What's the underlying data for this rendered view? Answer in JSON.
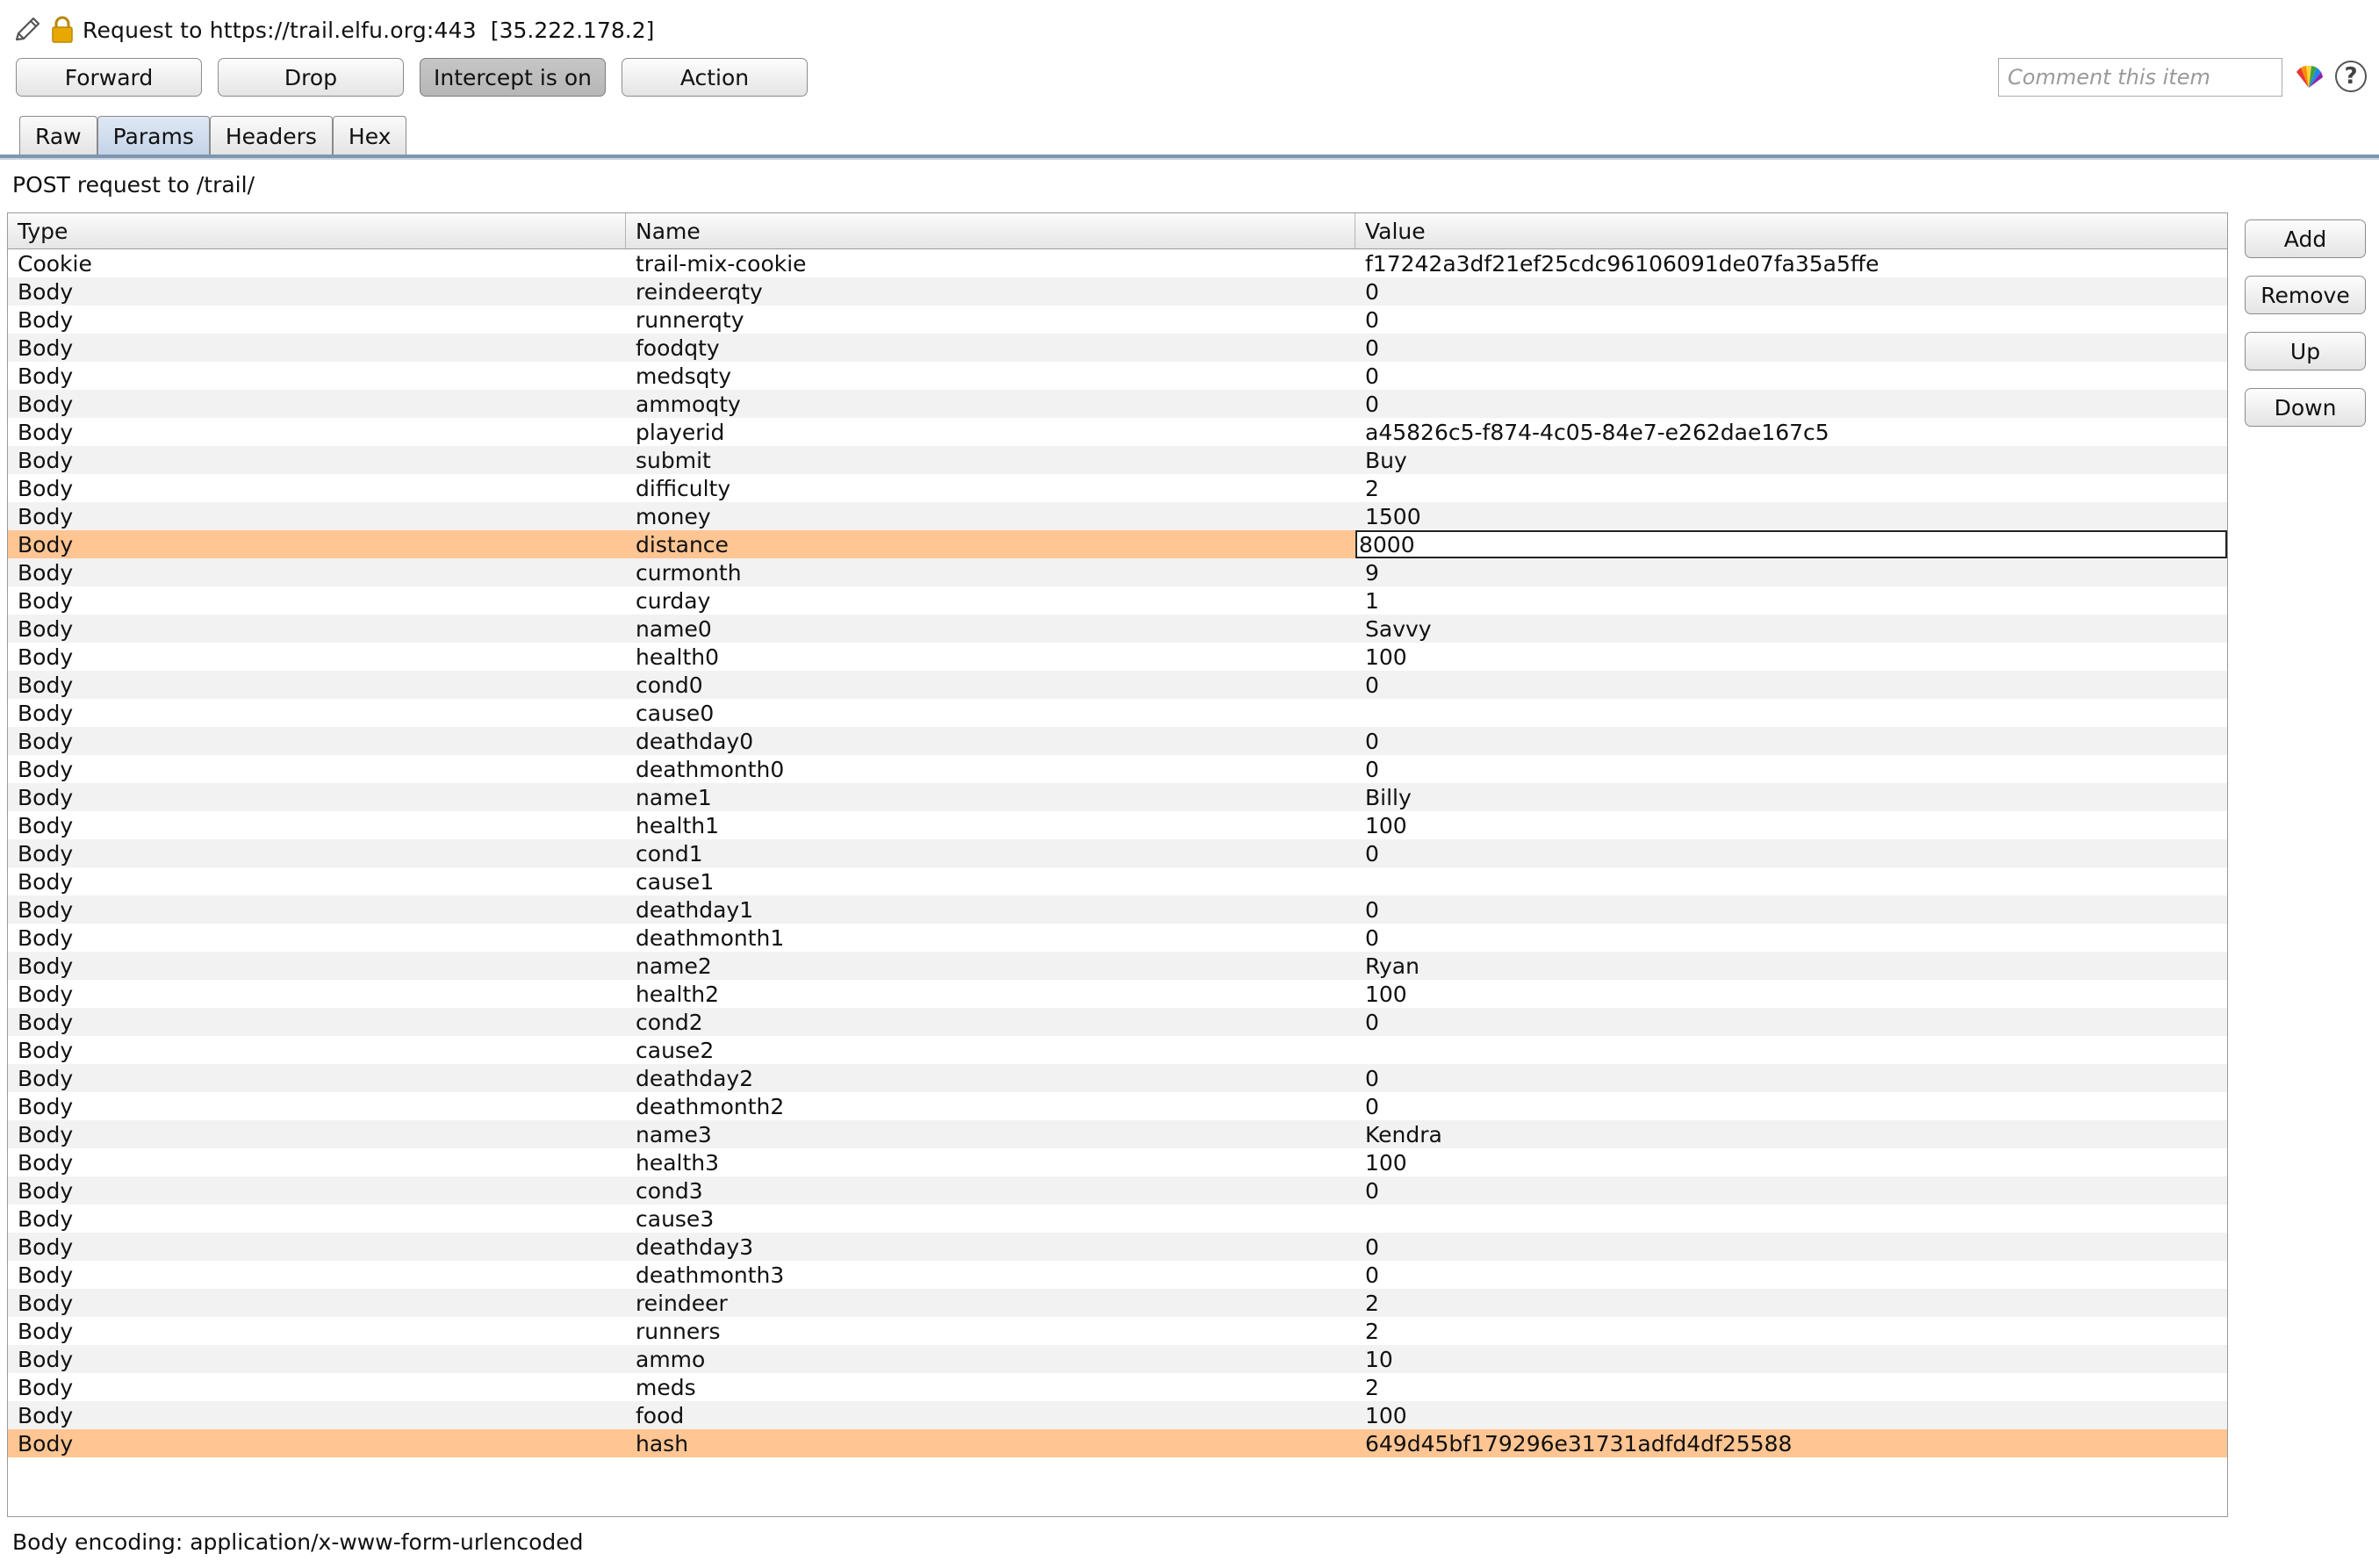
{
  "request_line": {
    "text": "Request to https://trail.elfu.org:443",
    "ip": "[35.222.178.2]"
  },
  "toolbar": {
    "forward": "Forward",
    "drop": "Drop",
    "intercept": "Intercept is on",
    "action": "Action",
    "comment_placeholder": "Comment this item"
  },
  "tabs": [
    {
      "label": "Raw"
    },
    {
      "label": "Params",
      "active": true
    },
    {
      "label": "Headers"
    },
    {
      "label": "Hex"
    }
  ],
  "request_summary": "POST request to /trail/",
  "table": {
    "headers": [
      "Type",
      "Name",
      "Value"
    ],
    "rows": [
      {
        "type": "Cookie",
        "name": "trail-mix-cookie",
        "value": "f17242a3df21ef25cdc96106091de07fa35a5ffe"
      },
      {
        "type": "Body",
        "name": "reindeerqty",
        "value": "0"
      },
      {
        "type": "Body",
        "name": "runnerqty",
        "value": "0"
      },
      {
        "type": "Body",
        "name": "foodqty",
        "value": "0"
      },
      {
        "type": "Body",
        "name": "medsqty",
        "value": "0"
      },
      {
        "type": "Body",
        "name": "ammoqty",
        "value": "0"
      },
      {
        "type": "Body",
        "name": "playerid",
        "value": "a45826c5-f874-4c05-84e7-e262dae167c5"
      },
      {
        "type": "Body",
        "name": "submit",
        "value": "Buy"
      },
      {
        "type": "Body",
        "name": "difficulty",
        "value": "2"
      },
      {
        "type": "Body",
        "name": "money",
        "value": "1500"
      },
      {
        "type": "Body",
        "name": "distance",
        "value": "8000",
        "selected": true,
        "editing": true
      },
      {
        "type": "Body",
        "name": "curmonth",
        "value": "9"
      },
      {
        "type": "Body",
        "name": "curday",
        "value": "1"
      },
      {
        "type": "Body",
        "name": "name0",
        "value": "Savvy"
      },
      {
        "type": "Body",
        "name": "health0",
        "value": "100"
      },
      {
        "type": "Body",
        "name": "cond0",
        "value": "0"
      },
      {
        "type": "Body",
        "name": "cause0",
        "value": ""
      },
      {
        "type": "Body",
        "name": "deathday0",
        "value": "0"
      },
      {
        "type": "Body",
        "name": "deathmonth0",
        "value": "0"
      },
      {
        "type": "Body",
        "name": "name1",
        "value": "Billy"
      },
      {
        "type": "Body",
        "name": "health1",
        "value": "100"
      },
      {
        "type": "Body",
        "name": "cond1",
        "value": "0"
      },
      {
        "type": "Body",
        "name": "cause1",
        "value": ""
      },
      {
        "type": "Body",
        "name": "deathday1",
        "value": "0"
      },
      {
        "type": "Body",
        "name": "deathmonth1",
        "value": "0"
      },
      {
        "type": "Body",
        "name": "name2",
        "value": "Ryan"
      },
      {
        "type": "Body",
        "name": "health2",
        "value": "100"
      },
      {
        "type": "Body",
        "name": "cond2",
        "value": "0"
      },
      {
        "type": "Body",
        "name": "cause2",
        "value": ""
      },
      {
        "type": "Body",
        "name": "deathday2",
        "value": "0"
      },
      {
        "type": "Body",
        "name": "deathmonth2",
        "value": "0"
      },
      {
        "type": "Body",
        "name": "name3",
        "value": "Kendra"
      },
      {
        "type": "Body",
        "name": "health3",
        "value": "100"
      },
      {
        "type": "Body",
        "name": "cond3",
        "value": "0"
      },
      {
        "type": "Body",
        "name": "cause3",
        "value": ""
      },
      {
        "type": "Body",
        "name": "deathday3",
        "value": "0"
      },
      {
        "type": "Body",
        "name": "deathmonth3",
        "value": "0"
      },
      {
        "type": "Body",
        "name": "reindeer",
        "value": "2"
      },
      {
        "type": "Body",
        "name": "runners",
        "value": "2"
      },
      {
        "type": "Body",
        "name": "ammo",
        "value": "10"
      },
      {
        "type": "Body",
        "name": "meds",
        "value": "2"
      },
      {
        "type": "Body",
        "name": "food",
        "value": "100"
      },
      {
        "type": "Body",
        "name": "hash",
        "value": "649d45bf179296e31731adfd4df25588",
        "selected": true
      }
    ]
  },
  "side_buttons": {
    "add": "Add",
    "remove": "Remove",
    "up": "Up",
    "down": "Down"
  },
  "footer": "Body encoding: application/x-www-form-urlencoded",
  "icons": {
    "pencil": "pencil-icon",
    "lock": "lock-icon",
    "colorwheel": "color-highlight-icon",
    "help": "help-icon"
  },
  "colors": {
    "selected_row": "#ffc592",
    "tab_active": "#c2d3e8",
    "lock_gold": "#e9a800"
  }
}
